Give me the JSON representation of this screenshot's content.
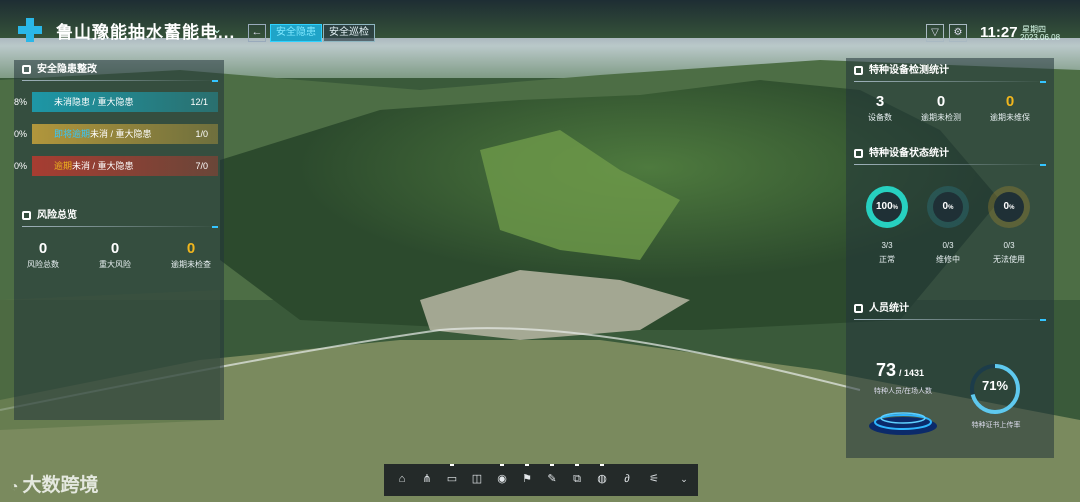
{
  "header": {
    "title": "鲁山豫能抽水蓄能电...",
    "back_icon": "arrow-left-icon",
    "tabs": [
      {
        "label": "安全隐患",
        "active": true
      },
      {
        "label": "安全巡检",
        "active": false
      }
    ],
    "tool_icons": [
      "filter-icon",
      "settings-icon"
    ],
    "time": "11:27",
    "weekday": "星期四",
    "date": "2023.06.08"
  },
  "hazard_panel": {
    "title": "安全隐患整改",
    "rows": [
      {
        "pct": "8%",
        "label": "未消隐患 / 重大隐患",
        "highlight": "",
        "rest": "",
        "count": "12/1",
        "fill": 0.08,
        "color": "#1aa2b6"
      },
      {
        "pct": "0%",
        "label": "",
        "highlight": "即将逾期",
        "rest": "未消 / 重大隐患",
        "count": "1/0",
        "fill": 0,
        "color": "#c4a13b"
      },
      {
        "pct": "0%",
        "label": "",
        "highlight": "逾期",
        "rest": "未消 / 重大隐患",
        "count": "7/0",
        "fill": 0,
        "color": "#b83a2f"
      }
    ]
  },
  "risk_panel": {
    "title": "风险总览",
    "stats": [
      {
        "value": "0",
        "label": "风险总数",
        "accent": false
      },
      {
        "value": "0",
        "label": "重大风险",
        "accent": false
      },
      {
        "value": "0",
        "label": "逾期未检查",
        "accent": true
      }
    ]
  },
  "equip_panel": {
    "title": "特种设备检测统计",
    "stats": [
      {
        "value": "3",
        "label": "设备数",
        "accent": false
      },
      {
        "value": "0",
        "label": "逾期未检测",
        "accent": false
      },
      {
        "value": "0",
        "label": "逾期未维保",
        "accent": true
      }
    ]
  },
  "status_panel": {
    "title": "特种设备状态统计",
    "gauges": [
      {
        "value": "100",
        "unit": "%",
        "ratio": "3/3",
        "label": "正常",
        "color": "#27d0c0",
        "fill": 1.0
      },
      {
        "value": "0",
        "unit": "%",
        "ratio": "0/3",
        "label": "维修中",
        "color": "#2a7e8f",
        "fill": 0
      },
      {
        "value": "0",
        "unit": "%",
        "ratio": "0/3",
        "label": "无法使用",
        "color": "#a98a2c",
        "fill": 0
      }
    ]
  },
  "people_panel": {
    "title": "人员统计",
    "count": "73",
    "total": "/ 1431",
    "count_label": "特种人员/在场人数",
    "rate": "71%",
    "rate_label": "特种证书上传率",
    "rate_fill": 0.71
  },
  "dock": {
    "icons": [
      "home-icon",
      "network-icon",
      "layers-icon",
      "book-icon",
      "location-icon",
      "flag-icon",
      "edit-icon",
      "copy-icon",
      "globe-icon",
      "draw-icon",
      "sliders-icon",
      "chevron-down-icon"
    ]
  },
  "watermark": "大数跨境",
  "colors": {
    "accent": "#2fd2ff",
    "warn": "#f1b61d",
    "danger": "#b83a2f"
  }
}
